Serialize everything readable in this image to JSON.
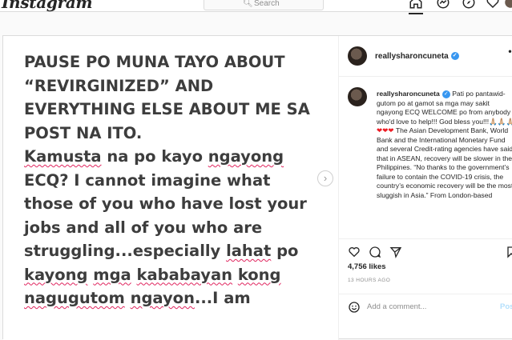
{
  "nav": {
    "logo": "Instagram",
    "search_placeholder": "Search",
    "icons": [
      "home-icon",
      "direct-messages-icon",
      "explore-compass-icon",
      "activity-heart-icon",
      "profile-avatar-icon"
    ]
  },
  "post": {
    "media_text": [
      {
        "t": "PAUSE PO MUNA TAYO ABOUT\n“REVIRGINIZED” AND\nEVERYTHING ELSE ABOUT ME SA\nPOST NA ITO.\n",
        "sq": false
      },
      {
        "t": "Kamusta",
        "sq": true
      },
      {
        "t": " na po kayo ",
        "sq": false
      },
      {
        "t": "ngayong",
        "sq": true
      },
      {
        "t": "\nECQ? I cannot imagine what\nthose of you who have lost your\njobs and all of you who are\nstruggling...especially ",
        "sq": false
      },
      {
        "t": "lahat",
        "sq": true
      },
      {
        "t": " po\n",
        "sq": false
      },
      {
        "t": "kayong",
        "sq": true
      },
      {
        "t": " ",
        "sq": false
      },
      {
        "t": "mga",
        "sq": true
      },
      {
        "t": " ",
        "sq": false
      },
      {
        "t": "kababayan",
        "sq": true
      },
      {
        "t": " ",
        "sq": false
      },
      {
        "t": "kong",
        "sq": true
      },
      {
        "t": "\n",
        "sq": false
      },
      {
        "t": "nagugutom",
        "sq": true
      },
      {
        "t": " ",
        "sq": false
      },
      {
        "t": "ngayon",
        "sq": true
      },
      {
        "t": "...I am",
        "sq": false
      }
    ],
    "next_button": "›",
    "username": "reallysharoncuneta",
    "verified_glyph": "✓",
    "more_menu": "•••",
    "caption_username": "reallysharoncuneta",
    "caption_text_part1": " Pati po pantawid-gutom po at gamot sa mga may sakit ngayong ECQ WELCOME po from anybody who'd love to help!!! God bless you!!!🙏🏼🙏🏼🙏🏼",
    "caption_hearts": "❤❤❤",
    "caption_text_part2": " The Asian Development Bank, World Bank and the International Monetary Fund and several Credit-rating agencies have said that in ASEAN, recovery will be slower in the Philippines. “No thanks to the government’s failure to contain the COVID-19 crisis, the country’s economic recovery will be the most sluggish in Asia.” From London-based",
    "likes": "4,756 likes",
    "time": "13 HOURS AGO",
    "comment_placeholder": "Add a comment...",
    "post_button": "Post"
  }
}
